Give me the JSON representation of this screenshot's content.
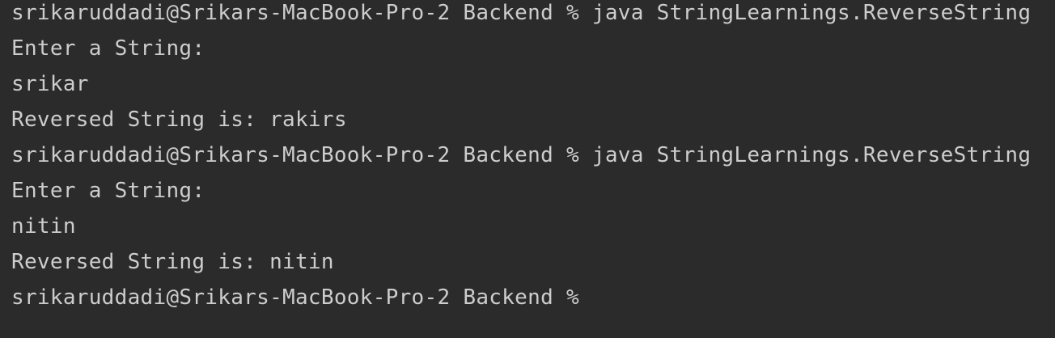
{
  "terminal": {
    "lines": [
      "srikaruddadi@Srikars-MacBook-Pro-2 Backend % java StringLearnings.ReverseString",
      "Enter a String:",
      "srikar",
      "Reversed String is: rakirs",
      "srikaruddadi@Srikars-MacBook-Pro-2 Backend % java StringLearnings.ReverseString",
      "Enter a String:",
      "nitin",
      "Reversed String is: nitin",
      "srikaruddadi@Srikars-MacBook-Pro-2 Backend %"
    ],
    "background_color": "#2b2b2b",
    "text_color": "#cdcdcd"
  }
}
